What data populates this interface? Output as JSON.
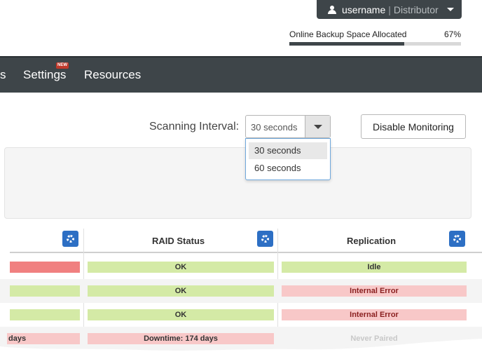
{
  "user_menu": {
    "username": "username",
    "separator": "|",
    "role": "Distributor"
  },
  "backup": {
    "label": "Online Backup Space Allocated",
    "percent_text": "67%",
    "percent": 67
  },
  "nav": {
    "partial_item": "s",
    "settings": "Settings",
    "new_badge": "NEW",
    "resources": "Resources"
  },
  "scanning": {
    "label": "Scanning Interval:",
    "selected": "30 seconds",
    "options": [
      "30 seconds",
      "60 seconds"
    ],
    "disable_button": "Disable Monitoring"
  },
  "table": {
    "columns": [
      "RAID Status",
      "Replication"
    ],
    "rows": [
      {
        "first": "",
        "first_status": "error",
        "raid": "OK",
        "replication": "Idle",
        "replication_status": "ok"
      },
      {
        "first": "",
        "first_status": "ok",
        "raid": "OK",
        "replication": "Internal Error",
        "replication_status": "error"
      },
      {
        "first": "",
        "first_status": "ok",
        "raid": "OK",
        "replication": "Internal Error",
        "replication_status": "error"
      },
      {
        "first": "days",
        "first_status": "warn",
        "raid": "Downtime: 174 days",
        "replication": "Never Paired",
        "replication_status": "none"
      }
    ]
  },
  "colors": {
    "nav": "#3e4549",
    "accent": "#2d6fc4",
    "ok": "#d4eaa6",
    "error": "#f8c8c8",
    "critical": "#f08080"
  }
}
